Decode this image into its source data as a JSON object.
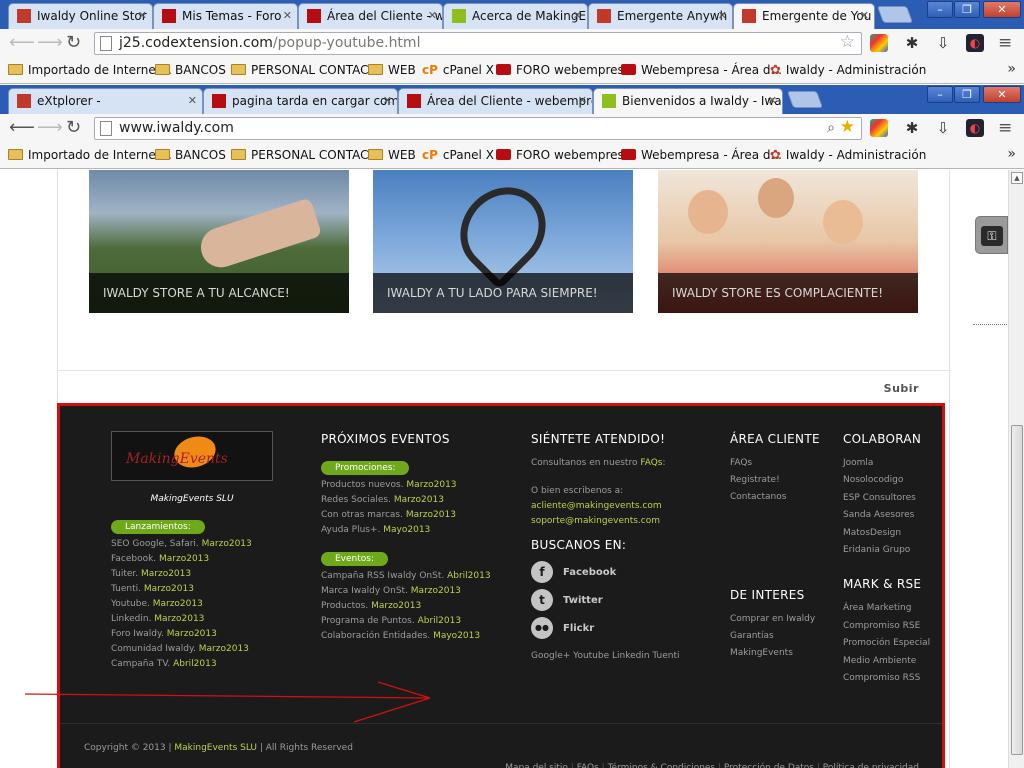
{
  "browser_back": {
    "tabs": [
      {
        "label": "Iwaldy Online Stor",
        "fav": "joomla-icon",
        "color": "#c0392b"
      },
      {
        "label": "Mis Temas - Foro",
        "fav": "webempresa-icon",
        "color": "#b50d12"
      },
      {
        "label": "Área del Cliente - w",
        "fav": "webempresa-icon",
        "color": "#b50d12"
      },
      {
        "label": "Acerca de MakingE",
        "fav": "iwaldy-icon",
        "color": "#8fbf1f"
      },
      {
        "label": "Emergente Anywh",
        "fav": "joomla-icon",
        "color": "#c0392b"
      },
      {
        "label": "Emergente de You",
        "fav": "joomla-icon",
        "color": "#c0392b",
        "active": true
      }
    ],
    "url_host": "j25.codextension.com",
    "url_path": "/popup-youtube.html"
  },
  "browser_front": {
    "tabs": [
      {
        "label": "eXtplorer -",
        "fav": "joomla-icon",
        "color": "#c0392b"
      },
      {
        "label": "pagina tarda en cargar como",
        "fav": "webempresa-icon",
        "color": "#b50d12"
      },
      {
        "label": "Área del Cliente - webempresa",
        "fav": "webempresa-icon",
        "color": "#b50d12"
      },
      {
        "label": "Bienvenidos a Iwaldy - Iwald",
        "fav": "iwaldy-icon",
        "color": "#8fbf1f",
        "active": true
      }
    ],
    "url": "www.iwaldy.com"
  },
  "bookmarks": [
    {
      "label": "Importado de Internet...",
      "icon": "folder"
    },
    {
      "label": "BANCOS",
      "icon": "folder"
    },
    {
      "label": "PERSONAL CONTACT",
      "icon": "folder"
    },
    {
      "label": "WEB",
      "icon": "folder"
    },
    {
      "label": "cPanel X",
      "icon": "cpanel"
    },
    {
      "label": "FORO webempresa",
      "icon": "webempresa"
    },
    {
      "label": "Webempresa - Área d...",
      "icon": "webempresa"
    },
    {
      "label": "Iwaldy - Administración",
      "icon": "joomla"
    }
  ],
  "banner_cards": [
    "IWALDY STORE A TU ALCANCE!",
    "IWALDY A TU LADO PARA SIEMPRE!",
    "IWALDY STORE ES COMPLACIENTE!"
  ],
  "subir": "Subir",
  "footer": {
    "logo_text": "MakingEvents",
    "company": "MakingEvents SLU",
    "lanzamientos_label": "Lanzamientos:",
    "lanzamientos": [
      {
        "t": "SEO Google, Safari.",
        "m": "Marzo2013"
      },
      {
        "t": "Facebook.",
        "m": "Marzo2013"
      },
      {
        "t": "Tuiter.",
        "m": "Marzo2013"
      },
      {
        "t": "Tuenti.",
        "m": "Marzo2013"
      },
      {
        "t": "Youtube.",
        "m": "Marzo2013"
      },
      {
        "t": "Linkedin.",
        "m": "Marzo2013"
      },
      {
        "t": "Foro Iwaldy.",
        "m": "Marzo2013"
      },
      {
        "t": "Comunidad Iwaldy.",
        "m": "Marzo2013"
      },
      {
        "t": "Campaña TV.",
        "m": "Abril2013"
      }
    ],
    "eventos_title": "PRÓXIMOS EVENTOS",
    "promociones_label": "Promociones:",
    "promociones": [
      {
        "t": "Productos nuevos.",
        "m": "Marzo2013"
      },
      {
        "t": "Redes Sociales.",
        "m": "Marzo2013"
      },
      {
        "t": "Con otras marcas.",
        "m": "Marzo2013"
      },
      {
        "t": "Ayuda Plus+.",
        "m": "Mayo2013"
      }
    ],
    "eventos_label": "Eventos:",
    "eventos": [
      {
        "t": "Campaña RSS Iwaldy OnSt.",
        "m": "Abril2013"
      },
      {
        "t": "Marca Iwaldy OnSt.",
        "m": "Marzo2013"
      },
      {
        "t": "Productos.",
        "m": "Marzo2013"
      },
      {
        "t": "Programa de Puntos.",
        "m": "Abril2013"
      },
      {
        "t": "Colaboración Entidades.",
        "m": "Mayo2013"
      }
    ],
    "atendido_title": "SIÉNTETE ATENDIDO!",
    "consultanos": "Consultanos en nuestro",
    "faqs": "FAQs",
    "escribenos": "O bien escribenos a:",
    "email1": "acliente@makingevents.com",
    "email2": "soporte@makingevents.com",
    "buscanos_title": "BUSCANOS EN:",
    "social": [
      {
        "label": "Facebook",
        "icon": "facebook-icon",
        "glyph": "f"
      },
      {
        "label": "Twitter",
        "icon": "twitter-icon",
        "glyph": "t"
      },
      {
        "label": "Flickr",
        "icon": "flickr-icon",
        "glyph": "●●"
      }
    ],
    "other_social": "Google+ Youtube Linkedin Tuenti",
    "area_title": "ÁREA CLIENTE",
    "area_links": [
      "FAQs",
      "Registrate!",
      "Contactanos"
    ],
    "colaboran_title": "COLABORAN",
    "colaboran_links": [
      "Joomla",
      "Nosolocodigo",
      "ESP Consultores",
      "Sanda Asesores",
      "MatosDesign",
      "Eridania Grupo"
    ],
    "interes_title": "DE INTERES",
    "interes_links": [
      "Comprar en Iwaldy",
      "Garantías",
      "MakingEvents"
    ],
    "mark_title": "MARK & RSE",
    "mark_links": [
      "Área Marketing",
      "Compromiso RSE",
      "Promoción Especial",
      "Medio Ambiente",
      "Compromiso RSS"
    ],
    "copyright_pre": "Copyright © 2013 |",
    "copyright_company": "MakingEvents SLU",
    "copyright_post": "| All Rights Reserved",
    "bottom_links": [
      "Mapa del sitio",
      "FAQs",
      "Términos & Condiciones",
      "Protección de Datos",
      "Política de privacidad"
    ]
  },
  "annotation_color": "#d21010"
}
